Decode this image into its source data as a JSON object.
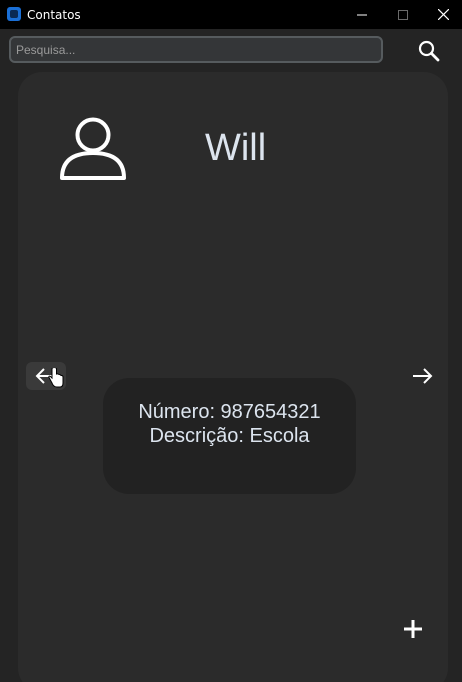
{
  "window": {
    "title": "Contatos",
    "icon": "app-icon",
    "controls": [
      "minimize-icon",
      "maximize-icon",
      "close-icon"
    ]
  },
  "search": {
    "value": "",
    "placeholder": "Pesquisa...",
    "button_icon": "search-icon"
  },
  "contact": {
    "avatar_icon": "user-icon",
    "name": "Will",
    "number_line": "Número: 987654321",
    "description_line": "Descrição: Escola"
  },
  "navigation": {
    "prev_icon": "arrow-left-icon",
    "next_icon": "arrow-right-icon"
  },
  "actions": {
    "add_icon": "plus-icon"
  },
  "colors": {
    "titlebar": "#000000",
    "background": "#242424",
    "card": "#2b2b2b",
    "info_box": "#222222",
    "text": "#dce4ee",
    "accent_icon": "#1a6fd6"
  }
}
